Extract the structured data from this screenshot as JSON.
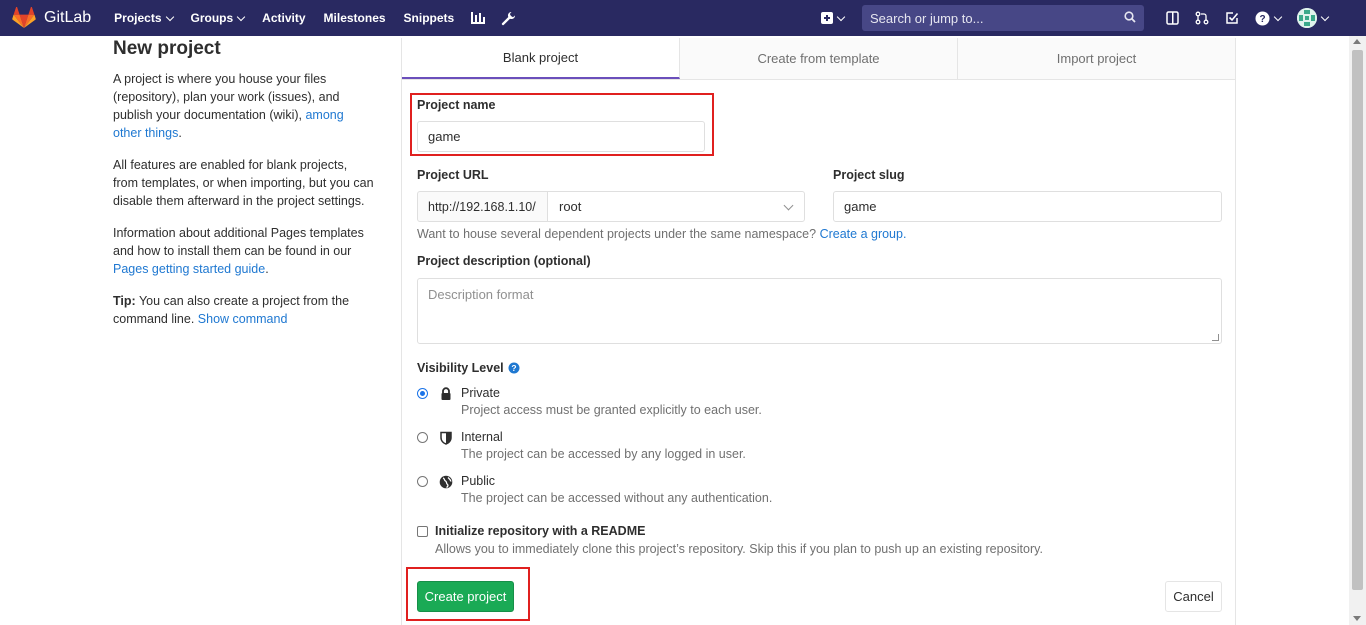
{
  "navbar": {
    "brand": "GitLab",
    "links": [
      {
        "label": "Projects",
        "dropdown": true
      },
      {
        "label": "Groups",
        "dropdown": true
      },
      {
        "label": "Activity",
        "dropdown": false
      },
      {
        "label": "Milestones",
        "dropdown": false
      },
      {
        "label": "Snippets",
        "dropdown": false
      }
    ],
    "search_placeholder": "Search or jump to...",
    "icons": [
      "chart-icon",
      "wrench-icon",
      "plus-square-icon",
      "sidebar-icon",
      "merge-request-icon",
      "todo-icon",
      "help-icon",
      "avatar"
    ]
  },
  "sidebar": {
    "title": "New project",
    "p1_text": "A project is where you house your files (repository), plan your work (issues), and publish your documentation (wiki),",
    "p1_link": "among other things",
    "p1_end": ".",
    "p2_text": "All features are enabled for blank projects, from templates, or when importing, but you can disable them afterward in the project settings.",
    "p3_text": "Information about additional Pages templates and how to install them can be found in our",
    "p3_link": "Pages getting started guide",
    "p3_end": ".",
    "tip_label": "Tip:",
    "tip_text": "You can also create a project from the command line.",
    "tip_link": "Show command"
  },
  "tabs": [
    {
      "label": "Blank project",
      "active": true
    },
    {
      "label": "Create from template",
      "active": false
    },
    {
      "label": "Import project",
      "active": false
    }
  ],
  "form": {
    "project_name_label": "Project name",
    "project_name_value": "game",
    "project_url_label": "Project URL",
    "url_prefix": "http://192.168.1.10/",
    "namespace": "root",
    "project_slug_label": "Project slug",
    "project_slug_value": "game",
    "namespace_help": "Want to house several dependent projects under the same namespace?",
    "namespace_help_link": "Create a group.",
    "description_label": "Project description (optional)",
    "description_placeholder": "Description format",
    "visibility_label": "Visibility Level",
    "visibility_options": [
      {
        "title": "Private",
        "desc": "Project access must be granted explicitly to each user.",
        "checked": true,
        "icon": "lock-icon"
      },
      {
        "title": "Internal",
        "desc": "The project can be accessed by any logged in user.",
        "checked": false,
        "icon": "shield-icon"
      },
      {
        "title": "Public",
        "desc": "The project can be accessed without any authentication.",
        "checked": false,
        "icon": "globe-icon"
      }
    ],
    "readme_label": "Initialize repository with a README",
    "readme_desc": "Allows you to immediately clone this project’s repository. Skip this if you plan to push up an existing repository.",
    "create_button": "Create project",
    "cancel_button": "Cancel"
  },
  "colors": {
    "navbar": "#292961",
    "primary_button": "#1aaa55",
    "link": "#1f78d1",
    "highlight": "#e0201f"
  }
}
